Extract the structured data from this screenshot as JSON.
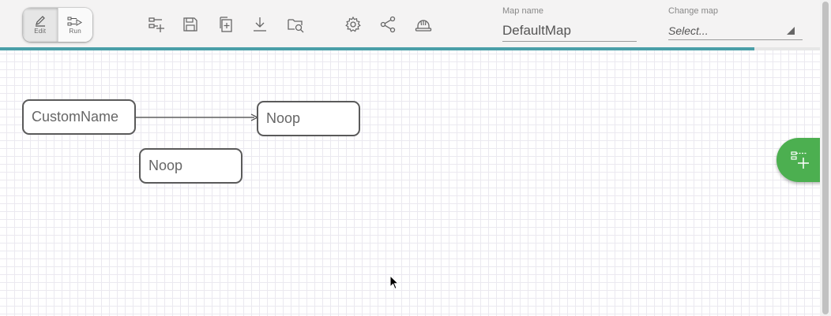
{
  "mode": {
    "edit_label": "Edit",
    "run_label": "Run"
  },
  "toolbar": {
    "icons": [
      "add-node-icon",
      "save-icon",
      "duplicate-icon",
      "download-icon",
      "browse-folder-icon",
      "settings-gear-icon",
      "share-icon",
      "helmet-icon"
    ]
  },
  "map_name": {
    "label": "Map name",
    "value": "DefaultMap"
  },
  "change_map": {
    "label": "Change map",
    "placeholder": "Select..."
  },
  "progress": {
    "percent": 92
  },
  "canvas": {
    "nodes": [
      {
        "label": "CustomName"
      },
      {
        "label": "Noop"
      },
      {
        "label": "Noop"
      }
    ]
  },
  "fab": {
    "icon": "add-node-icon"
  },
  "colors": {
    "accent": "#4a9fa8",
    "fab": "#4caf50",
    "node_border": "#5a5a5a"
  }
}
